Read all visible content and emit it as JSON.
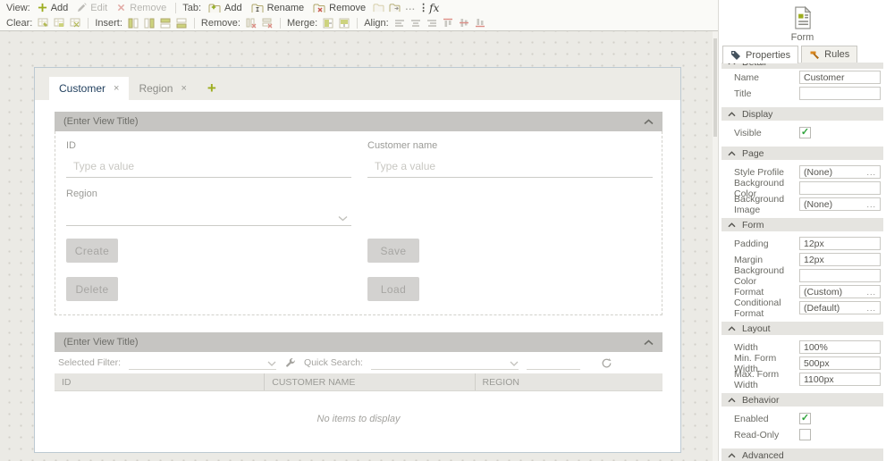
{
  "colors": {
    "accent_green": "#9dad1f",
    "accent_orange": "#d9871f",
    "check_green": "#2fa33b",
    "active_tab_text": "#1e3d5c",
    "selection_border": "#bcc9d2"
  },
  "toolbar": {
    "row1": {
      "view_label": "View:",
      "add_label": "Add",
      "edit_label": "Edit",
      "remove_label": "Remove",
      "tab_label": "Tab:",
      "tab_add_label": "Add",
      "tab_rename_label": "Rename",
      "tab_remove_label": "Remove",
      "more_glyph": "...",
      "overflow_glyph": "⋮",
      "fx_label": "fx"
    },
    "row2": {
      "clear_label": "Clear:",
      "insert_label": "Insert:",
      "remove_label": "Remove:",
      "merge_label": "Merge:",
      "align_label": "Align:"
    }
  },
  "designer": {
    "tabs": [
      {
        "label": "Customer",
        "close_glyph": "×"
      },
      {
        "label": "Region",
        "close_glyph": "×"
      }
    ],
    "add_tab_glyph": "+",
    "view1": {
      "title": "(Enter View Title)",
      "id_field": {
        "label": "ID",
        "placeholder": "Type a value"
      },
      "customer_name_field": {
        "label": "Customer name",
        "placeholder": "Type a value"
      },
      "region_field": {
        "label": "Region"
      },
      "buttons": {
        "create": "Create",
        "save": "Save",
        "delete": "Delete",
        "load": "Load"
      }
    },
    "view2": {
      "title": "(Enter View Title)",
      "selected_filter_label": "Selected Filter:",
      "quick_search_label": "Quick Search:",
      "table": {
        "columns": [
          "ID",
          "CUSTOMER NAME",
          "REGION"
        ],
        "empty_message": "No items to display"
      }
    }
  },
  "panel": {
    "widget_label": "Form",
    "tabs": {
      "properties": "Properties",
      "rules": "Rules"
    },
    "ellipsis": "...",
    "sections": {
      "detail": "Detail",
      "display": "Display",
      "page": "Page",
      "form": "Form",
      "layout": "Layout",
      "behavior": "Behavior",
      "advanced": "Advanced"
    },
    "fields": {
      "name": {
        "label": "Name",
        "value": "Customer"
      },
      "title": {
        "label": "Title",
        "value": ""
      },
      "visible": {
        "label": "Visible",
        "checked": true
      },
      "style_profile": {
        "label": "Style Profile",
        "value": "(None)"
      },
      "background_color_page": {
        "label": "Background Color",
        "value": ""
      },
      "background_image": {
        "label": "Background Image",
        "value": "(None)"
      },
      "padding": {
        "label": "Padding",
        "value": "12px"
      },
      "margin": {
        "label": "Margin",
        "value": "12px"
      },
      "background_color_form": {
        "label": "Background Color",
        "value": ""
      },
      "format": {
        "label": "Format",
        "value": "(Custom)"
      },
      "conditional_format": {
        "label": "Conditional Format",
        "value": "(Default)"
      },
      "width": {
        "label": "Width",
        "value": "100%"
      },
      "min_form_width": {
        "label": "Min. Form Width",
        "value": "500px"
      },
      "max_form_width": {
        "label": "Max. Form Width",
        "value": "1100px"
      },
      "enabled": {
        "label": "Enabled",
        "checked": true
      },
      "read_only": {
        "label": "Read-Only",
        "checked": false
      }
    }
  }
}
